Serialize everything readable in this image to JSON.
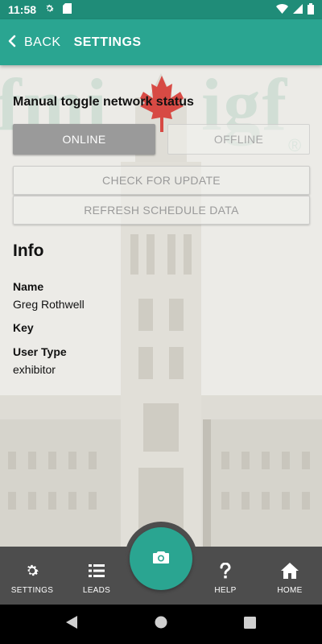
{
  "status_bar": {
    "time": "11:58",
    "icons": [
      "gear-icon",
      "sd-card-icon",
      "wifi-icon",
      "signal-icon",
      "battery-icon"
    ]
  },
  "app_bar": {
    "back_label": "BACK",
    "title": "SETTINGS"
  },
  "background": {
    "watermark_left": "fmi",
    "watermark_right": "igf",
    "watermark_reg": "®"
  },
  "network": {
    "heading": "Manual toggle network status",
    "online_label": "ONLINE",
    "offline_label": "OFFLINE",
    "selected": "ONLINE"
  },
  "actions": {
    "check_update_label": "CHECK FOR UPDATE",
    "refresh_label": "REFRESH SCHEDULE DATA"
  },
  "info": {
    "heading": "Info",
    "name_label": "Name",
    "name_value": "Greg Rothwell",
    "key_label": "Key",
    "key_value": "",
    "user_type_label": "User Type",
    "user_type_value": "exhibitor"
  },
  "bottom_nav": {
    "settings_label": "SETTINGS",
    "leads_label": "LEADS",
    "help_label": "HELP",
    "home_label": "HOME",
    "fab_icon": "camera-icon"
  },
  "colors": {
    "accent": "#2aa591",
    "status_bar": "#1f8c78",
    "nav_background": "#4d4d4d"
  }
}
